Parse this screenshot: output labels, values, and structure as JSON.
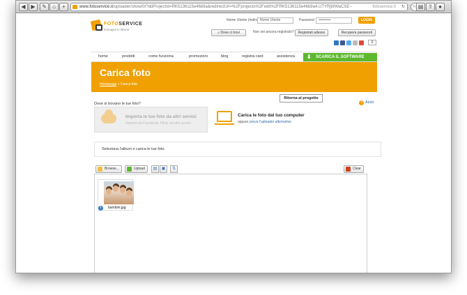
{
  "browser": {
    "url_host": "www.fotoservice.it",
    "url_path": "/uploader/show/0/?ddProjectId=RK5136115e46b9a&redirectUrl=%2Fprojects%2Fedit%2FRK5136115e46b9a4.UTYRjWWaCSE--",
    "page_title": "fotoservice.it",
    "search_placeholder": "Rendez"
  },
  "header": {
    "brand": "FOTO",
    "brand_accent": "SERVICE",
    "tagline": "immagini in libertà",
    "username_label": "Nome Utente (indirizzo email)",
    "username_value": "Nome Utente",
    "password_label": "Password",
    "password_value": "••••••••••",
    "login_label": "LOGIN",
    "where_button": "Dove ci trovi",
    "not_registered": "Non sei ancora registrato?",
    "register_button": "Registrati adesso",
    "recover_button": "Recupera password",
    "cart_count": "0"
  },
  "nav": {
    "items": [
      "home",
      "prodotti",
      "come funziona",
      "promozioni",
      "blog",
      "registra card",
      "assistenza"
    ],
    "download": "SCARICA IL SOFTWARE"
  },
  "hero": {
    "title": "Carica foto",
    "crumb_home": "Homepage",
    "crumb_current": "» Carica foto"
  },
  "main": {
    "back_button": "Ritorna al progetto",
    "where_question": "Dove si trovano le tue foto?",
    "help": "Aiuto",
    "import_title": "Importa le tue foto da altri servizi",
    "import_sub": "Importa da Facebook, Flickr ed altri servizi",
    "upload_title": "Carica le foto dal tuo computer",
    "upload_sub_prefix": "oppure",
    "upload_sub_link": "prova l'uploader alternativo",
    "select_text": "Seleziona l'album e carica le tue foto."
  },
  "uploader": {
    "browse": "Browse...",
    "upload": "Upload",
    "clear": "Clear",
    "files": [
      {
        "name": "bambini.jpg"
      }
    ]
  }
}
